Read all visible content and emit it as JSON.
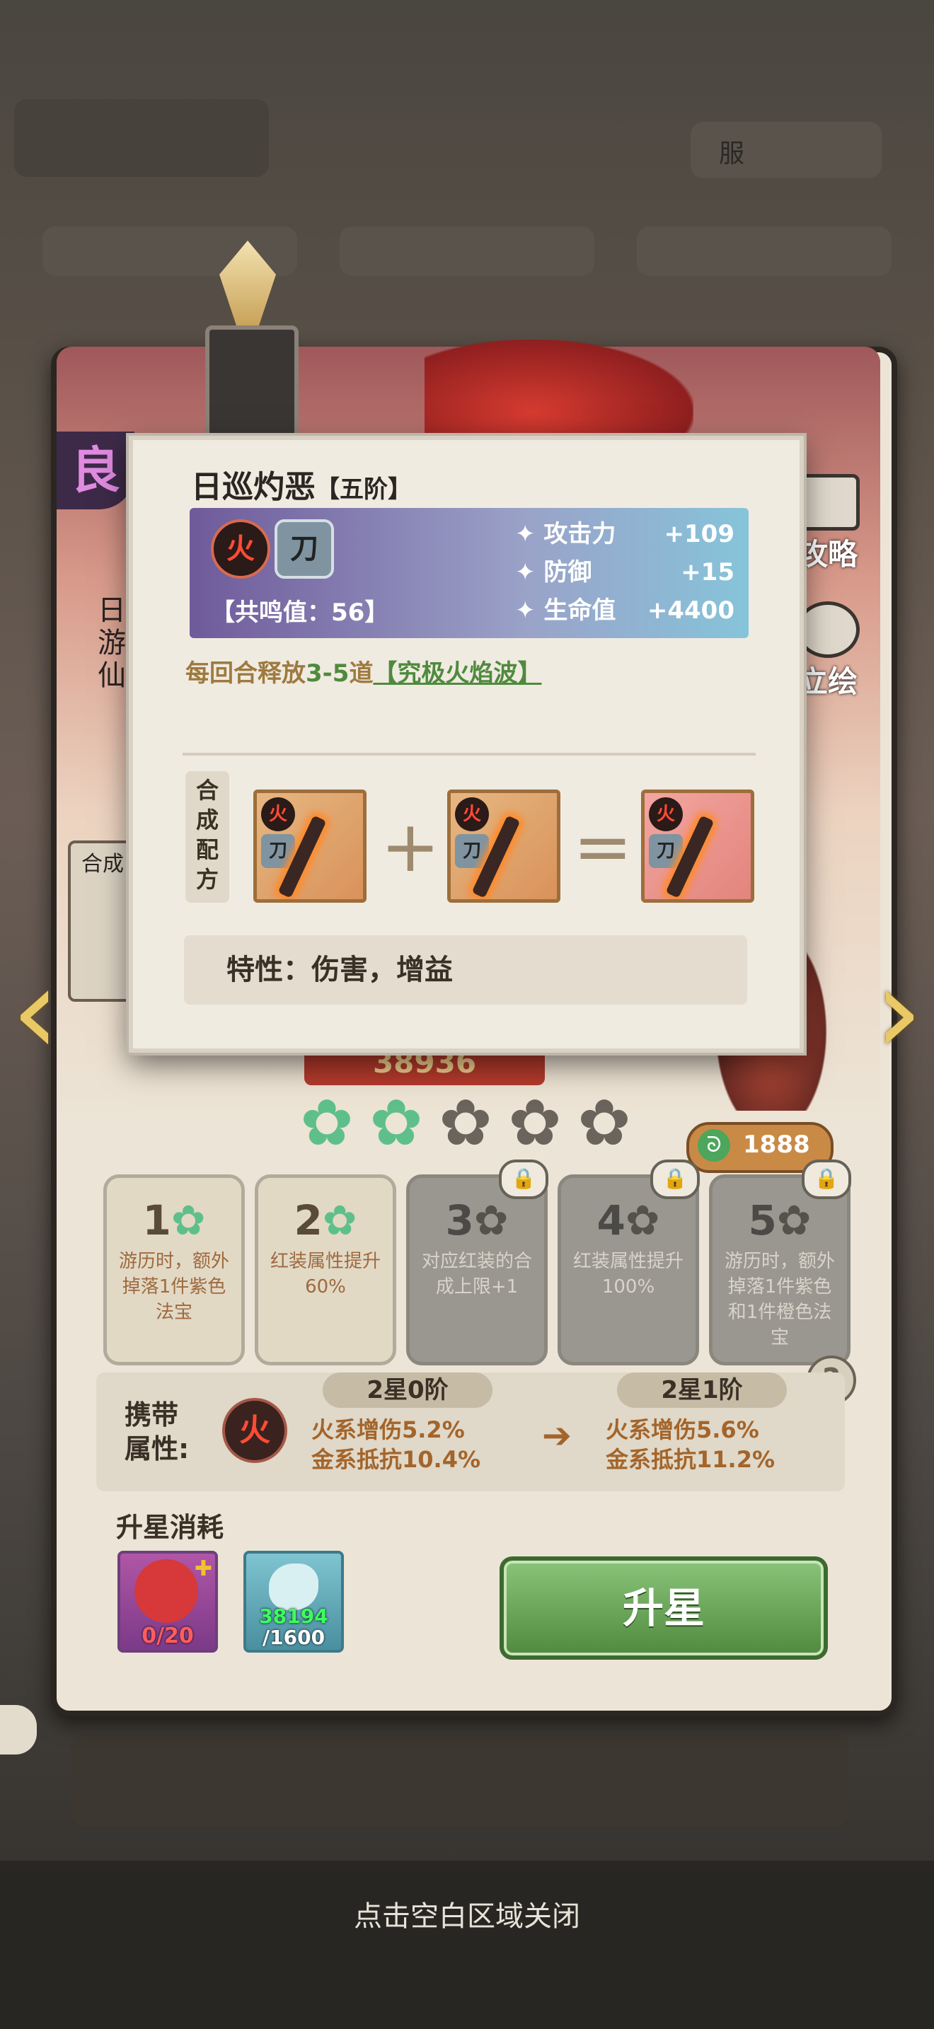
{
  "background": {
    "filter_label": "服",
    "hero_side_label": "日游仙",
    "hero_side_rank": "良",
    "side_synth_label": "合成",
    "combat_power": "38936",
    "currency_value": "1888",
    "guide_label": "攻略",
    "portrait_label": "立绘"
  },
  "stars": {
    "filled": 2,
    "total": 5
  },
  "star_slots": [
    {
      "num": "1",
      "text": "游历时，额外掉落1件紫色法宝",
      "locked": false
    },
    {
      "num": "2",
      "text": "红装属性提升60%",
      "locked": false
    },
    {
      "num": "3",
      "text": "对应红装的合成上限+1",
      "locked": true
    },
    {
      "num": "4",
      "text": "红装属性提升100%",
      "locked": true
    },
    {
      "num": "5",
      "text": "游历时，额外掉落1件紫色和1件橙色法宝",
      "locked": true
    }
  ],
  "carry": {
    "label": "携带属性:",
    "element_icon": "火",
    "current": {
      "title": "2星0阶",
      "lines": [
        "火系增伤5.2%",
        "金系抵抗10.4%"
      ]
    },
    "next": {
      "title": "2星1阶",
      "lines": [
        "火系增伤5.6%",
        "金系抵抗11.2%"
      ]
    }
  },
  "cost": {
    "label": "升星消耗",
    "hero_shards": "0/20",
    "stone_have": "38194",
    "stone_need": "/1600",
    "upgrade_button": "升星"
  },
  "footer_hint": "点击空白区域关闭",
  "tooltip": {
    "title": "日巡灼恶",
    "tier": "【五阶】",
    "element_tag": "火",
    "type_tag": "刀",
    "resonance": "【共鸣值：56】",
    "stats": [
      {
        "name": "攻击力",
        "value": "+109"
      },
      {
        "name": "防御",
        "value": "+15"
      },
      {
        "name": "生命值",
        "value": "+4400"
      }
    ],
    "effect_prefix": "每回合释放",
    "effect_count": "3-5",
    "effect_mid": "道",
    "effect_skill": "【究极火焰波】",
    "recipe_label": "合成配方",
    "plus": "+",
    "equals": "=",
    "traits": "特性：伤害，增益"
  },
  "colors": {
    "accent_green": "#4f8a3e",
    "fire_red": "#ff4b36",
    "gold": "#e9c966"
  }
}
